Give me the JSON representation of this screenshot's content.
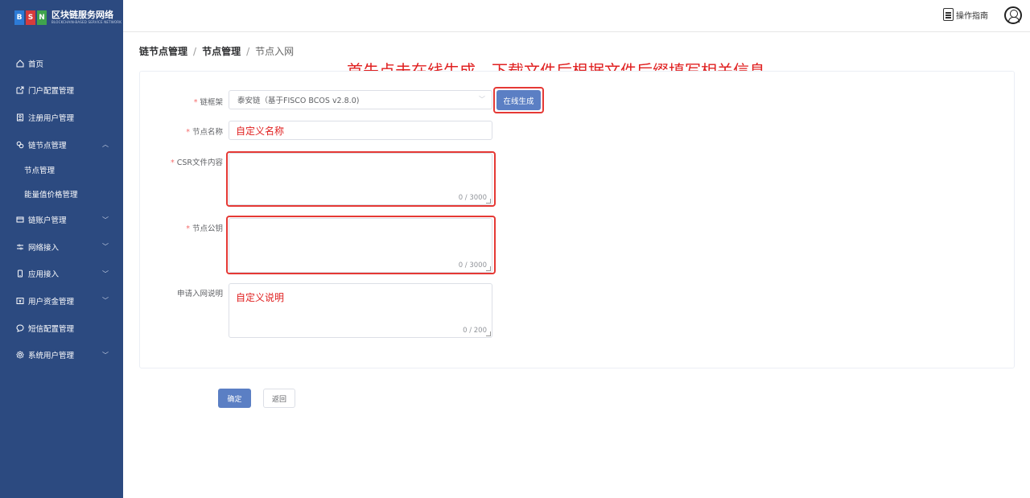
{
  "logo": {
    "letters": [
      "B",
      "S",
      "N"
    ],
    "title": "区块链服务网络",
    "subtitle": "BLOCKCHAIN-BASED SERVICE NETWORK"
  },
  "sidebar": {
    "items": [
      {
        "label": "首页",
        "icon": "home-icon"
      },
      {
        "label": "门户配置管理",
        "icon": "external-link-icon"
      },
      {
        "label": "注册用户管理",
        "icon": "user-card-icon"
      },
      {
        "label": "链节点管理",
        "icon": "node-icon",
        "expanded": true
      },
      {
        "label": "链账户管理",
        "icon": "wallet-icon"
      },
      {
        "label": "网络接入",
        "icon": "sliders-icon"
      },
      {
        "label": "应用接入",
        "icon": "phone-icon"
      },
      {
        "label": "用户资金管理",
        "icon": "money-icon"
      },
      {
        "label": "短信配置管理",
        "icon": "chat-icon"
      },
      {
        "label": "系统用户管理",
        "icon": "gear-icon"
      }
    ],
    "subitems": [
      "节点管理",
      "能量值价格管理"
    ]
  },
  "header": {
    "guide_label": "操作指南"
  },
  "breadcrumb": {
    "level1": "链节点管理",
    "level2": "节点管理",
    "current": "节点入网",
    "sep": "/"
  },
  "annotation": "首先点击在线生成，下载文件后根据文件后缀填写相关信息",
  "form": {
    "framework": {
      "label": "链框架",
      "value": "泰安链（基于FISCO BCOS v2.8.0)"
    },
    "generate_button": "在线生成",
    "node_name": {
      "label": "节点名称",
      "value": "自定义名称"
    },
    "csr": {
      "label": "CSR文件内容",
      "value": "",
      "counter": "0 / 3000"
    },
    "public_key": {
      "label": "节点公钥",
      "value": "",
      "counter": "0 / 3000"
    },
    "description": {
      "label": "申请入网说明",
      "value": "自定义说明",
      "counter": "0 / 200"
    }
  },
  "actions": {
    "confirm": "确定",
    "back": "返回"
  },
  "colors": {
    "sidebar_bg": "#2c4a80",
    "primary": "#5b7fc4",
    "annotation": "#e02020",
    "highlight_border": "#e53935"
  }
}
